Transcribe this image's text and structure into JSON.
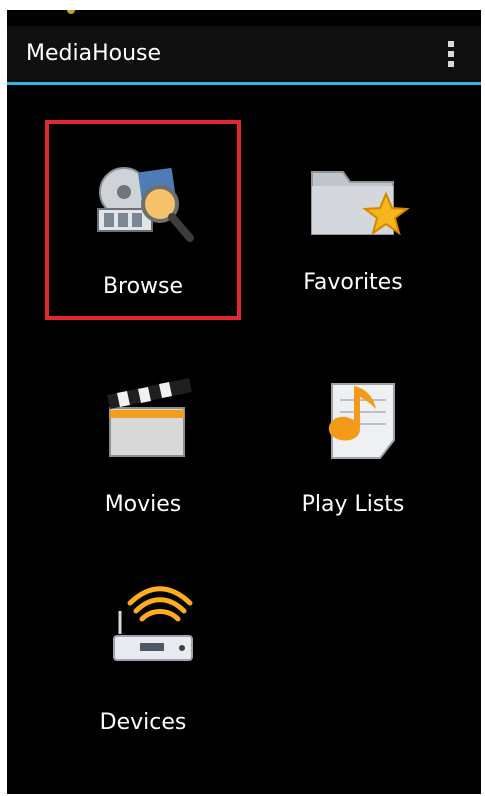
{
  "app": {
    "title": "MediaHouse",
    "overflow_icon": "overflow-menu-icon"
  },
  "colors": {
    "background": "#000000",
    "action_bar": "#101010",
    "accent": "#33b5e5",
    "selection": "#e0282e",
    "text": "#ffffff"
  },
  "menu": {
    "items": [
      {
        "label": "Browse",
        "icon": "browse-media-icon",
        "selected": true
      },
      {
        "label": "Favorites",
        "icon": "favorites-folder-icon",
        "selected": false
      },
      {
        "label": "Movies",
        "icon": "clapperboard-icon",
        "selected": false
      },
      {
        "label": "Play Lists",
        "icon": "music-note-icon",
        "selected": false
      },
      {
        "label": "Devices",
        "icon": "wifi-router-icon",
        "selected": false
      }
    ]
  }
}
